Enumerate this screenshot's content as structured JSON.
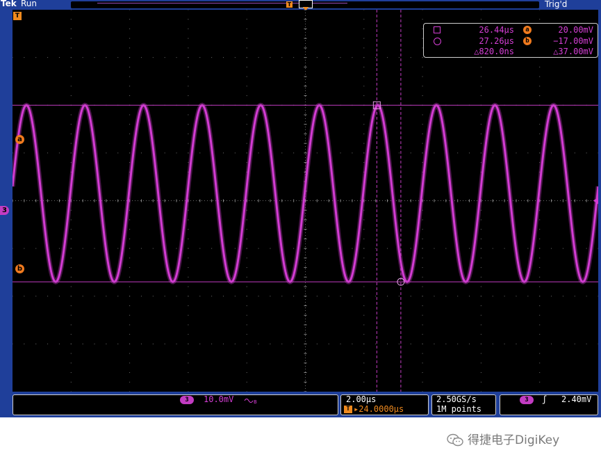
{
  "header": {
    "brand": "Tek",
    "status": "Run",
    "trigger_status": "Trig'd"
  },
  "markers": {
    "trigger_position": "T",
    "channel": "3",
    "cursor_a": "a",
    "cursor_b": "b"
  },
  "cursor_readout": {
    "time_a": "26.44µs",
    "time_b": "27.26µs",
    "time_delta": "△820.0ns",
    "volt_a": "20.00mV",
    "volt_b": "−17.00mV",
    "volt_delta": "△37.00mV"
  },
  "bottom_bar": {
    "channel_badge": "3",
    "channel_scale": "10.0mV",
    "bandwidth_icon": "bw-limit-icon",
    "timebase": "2.00µs",
    "trigger_offset": "▸24.0000µs",
    "sample_rate": "2.50GS/s",
    "record_length": "1M points",
    "trigger_source": "3",
    "trigger_slope": "ʃ",
    "trigger_level": "2.40mV"
  },
  "colors": {
    "frame": "#1f3f9a",
    "trace": "#d23cd2",
    "cursor": "#c23cc2",
    "trigger": "#f08a1e",
    "grid": "#6f6f6f"
  },
  "waveform": {
    "type": "sine",
    "cycles_visible": 10.0,
    "volt_a": 20.0,
    "volt_b": -17.0,
    "volts_per_div": 10.0,
    "time_per_div": 2.0
  },
  "watermark": {
    "text": "得捷电子DigiKey",
    "icon": "wechat-icon"
  }
}
